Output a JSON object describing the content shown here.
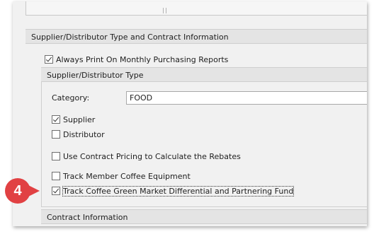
{
  "section_main": {
    "title": "Supplier/Distributor Type and Contract Information",
    "always_print_label": "Always Print On Monthly Purchasing Reports",
    "always_print_checked": true
  },
  "supplier_type": {
    "title": "Supplier/Distributor Type",
    "category_label": "Category:",
    "category_value": "FOOD",
    "supplier_label": "Supplier",
    "supplier_checked": true,
    "distributor_label": "Distributor",
    "distributor_checked": false,
    "contract_pricing_label": "Use Contract Pricing to Calculate the Rebates",
    "contract_pricing_checked": false,
    "track_equipment_label": "Track Member Coffee Equipment",
    "track_equipment_checked": false,
    "track_green_label": "Track Coffee Green Market Differential and Partnering Fund",
    "track_green_checked": true
  },
  "contract_section": {
    "title": "Contract Information"
  },
  "callout": {
    "step_number": "4",
    "color": "#e14143"
  }
}
